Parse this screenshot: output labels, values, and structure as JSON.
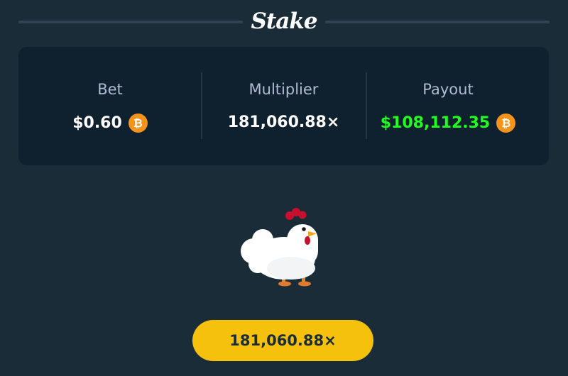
{
  "brand": {
    "logo_text": "Stake"
  },
  "stats": {
    "bet": {
      "label": "Bet",
      "value": "$0.60",
      "currency_icon": "bitcoin-icon"
    },
    "multiplier": {
      "label": "Multiplier",
      "value": "181,060.88×"
    },
    "payout": {
      "label": "Payout",
      "value": "$108,112.35",
      "currency_icon": "bitcoin-icon"
    }
  },
  "character": {
    "icon": "chicken"
  },
  "result_badge": {
    "text": "181,060.88×"
  },
  "colors": {
    "background": "#1a2c38",
    "panel": "#0f212e",
    "payout_green": "#1fff20",
    "badge_yellow": "#f5c10c",
    "bitcoin_orange": "#f7931a"
  }
}
